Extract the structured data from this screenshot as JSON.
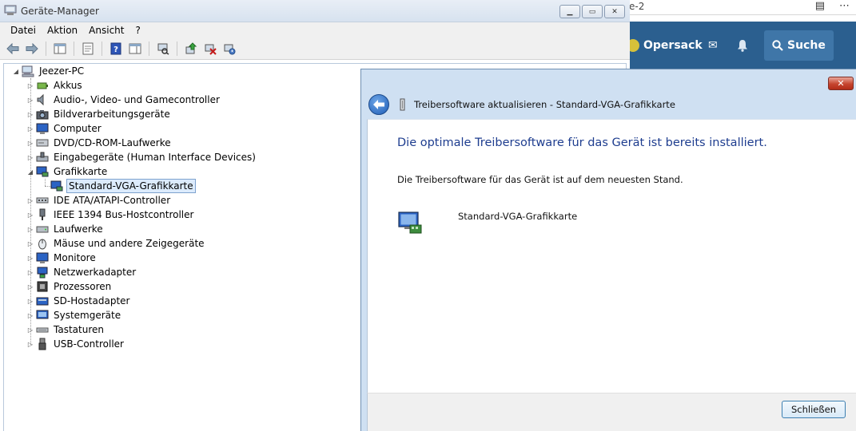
{
  "browser": {
    "tab_text": "e-2",
    "forum_nav": {
      "user_label": "Opersack",
      "search_label": "Suche"
    }
  },
  "device_manager": {
    "title": "Geräte-Manager",
    "window_buttons": [
      "▁",
      "▭",
      "✕"
    ],
    "menu": [
      "Datei",
      "Aktion",
      "Ansicht",
      "?"
    ],
    "tree": {
      "root": "Jeezer-PC",
      "categories": [
        {
          "label": "Akkus",
          "icon": "battery-icon",
          "expanded": false
        },
        {
          "label": "Audio-, Video- und Gamecontroller",
          "icon": "speaker-icon",
          "expanded": false
        },
        {
          "label": "Bildverarbeitungsgeräte",
          "icon": "camera-icon",
          "expanded": false
        },
        {
          "label": "Computer",
          "icon": "monitor-icon",
          "expanded": false
        },
        {
          "label": "DVD/CD-ROM-Laufwerke",
          "icon": "disc-drive-icon",
          "expanded": false
        },
        {
          "label": "Eingabegeräte (Human Interface Devices)",
          "icon": "hid-icon",
          "expanded": false
        },
        {
          "label": "Grafikkarte",
          "icon": "display-adapter-icon",
          "expanded": true,
          "children": [
            {
              "label": "Standard-VGA-Grafikkarte",
              "icon": "display-adapter-icon",
              "selected": true
            }
          ]
        },
        {
          "label": "IDE ATA/ATAPI-Controller",
          "icon": "ide-controller-icon",
          "expanded": false
        },
        {
          "label": "IEEE 1394 Bus-Hostcontroller",
          "icon": "firewire-icon",
          "expanded": false
        },
        {
          "label": "Laufwerke",
          "icon": "drive-icon",
          "expanded": false
        },
        {
          "label": "Mäuse und andere Zeigegeräte",
          "icon": "mouse-icon",
          "expanded": false
        },
        {
          "label": "Monitore",
          "icon": "monitor-icon",
          "expanded": false
        },
        {
          "label": "Netzwerkadapter",
          "icon": "network-icon",
          "expanded": false
        },
        {
          "label": "Prozessoren",
          "icon": "processor-icon",
          "expanded": false
        },
        {
          "label": "SD-Hostadapter",
          "icon": "sd-card-icon",
          "expanded": false
        },
        {
          "label": "Systemgeräte",
          "icon": "system-device-icon",
          "expanded": false
        },
        {
          "label": "Tastaturen",
          "icon": "keyboard-icon",
          "expanded": false
        },
        {
          "label": "USB-Controller",
          "icon": "usb-icon",
          "expanded": false
        }
      ]
    }
  },
  "dialog": {
    "title": "Treibersoftware aktualisieren - Standard-VGA-Grafikkarte",
    "close_glyph": "✕",
    "heading": "Die optimale Treibersoftware für das Gerät ist bereits installiert.",
    "message": "Die Treibersoftware für das Gerät ist auf dem neuesten Stand.",
    "device_name": "Standard-VGA-Grafikkarte",
    "close_button": "Schließen"
  },
  "colors": {
    "heading_blue": "#1e3d8f",
    "forum_nav": "#2b5f8f",
    "selection": "#dcebfc"
  }
}
